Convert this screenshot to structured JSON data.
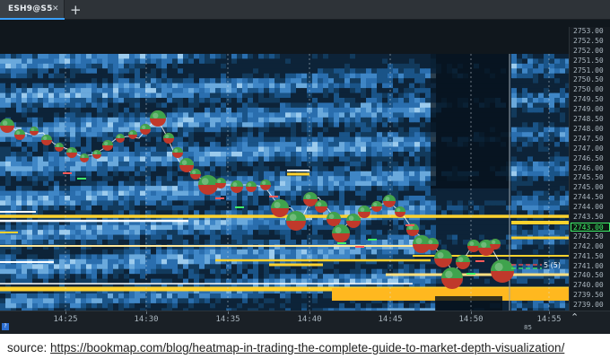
{
  "tab": {
    "label": "ESH9@S5",
    "close_icon": "close-icon",
    "add_icon": "plus-icon"
  },
  "price_axis": {
    "ticks": [
      "2753.00",
      "2752.50",
      "2752.00",
      "2751.50",
      "2751.00",
      "2750.50",
      "2750.00",
      "2749.50",
      "2749.00",
      "2748.50",
      "2748.00",
      "2747.50",
      "2747.00",
      "2746.50",
      "2746.00",
      "2745.50",
      "2745.00",
      "2744.50",
      "2744.00",
      "2743.50",
      "2743.00",
      "2742.50",
      "2742.00",
      "2741.50",
      "2741.00",
      "2740.50",
      "2740.00",
      "2739.50",
      "2739.00"
    ],
    "current_price": "2743.00",
    "current_index": 20
  },
  "time_axis": {
    "labels": [
      "14:25",
      "14:30",
      "14:35",
      "14:40",
      "14:45",
      "14:50",
      "14:55"
    ],
    "badge": "?",
    "number": "85"
  },
  "order_label": "5 (5)",
  "colors": {
    "background": "#10171d",
    "liquidity_low": "#123a5c",
    "liquidity_mid": "#3f86c6",
    "liquidity_high": "#bfe0f5",
    "large_order": "#ffd22e",
    "bubble_buy": "#3fa34d",
    "bubble_sell": "#c0392b",
    "current_price": "#3ef06a"
  },
  "source_caption": {
    "prefix": "source: ",
    "link_text": "https://bookmap.com/blog/heatmap-in-trading-the-complete-guide-to-market-depth-visualization/"
  }
}
